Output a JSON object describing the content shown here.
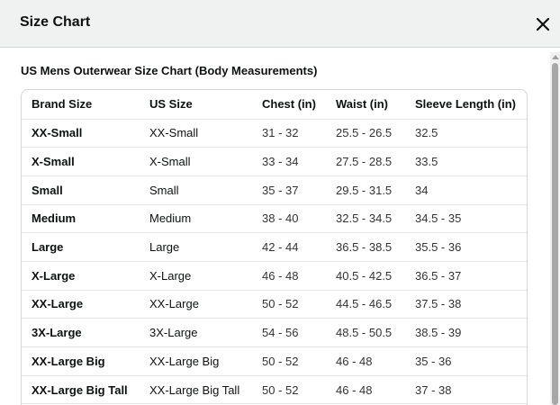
{
  "modal": {
    "title": "Size Chart"
  },
  "chart": {
    "heading": "US Mens Outerwear Size Chart (Body Measurements)",
    "columns": [
      "Brand Size",
      "US Size",
      "Chest (in)",
      "Waist (in)",
      "Sleeve Length (in)"
    ],
    "rows": [
      [
        "XX-Small",
        "XX-Small",
        "31 - 32",
        "25.5 - 26.5",
        "32.5"
      ],
      [
        "X-Small",
        "X-Small",
        "33 - 34",
        "27.5 - 28.5",
        "33.5"
      ],
      [
        "Small",
        "Small",
        "35 - 37",
        "29.5 - 31.5",
        "34"
      ],
      [
        "Medium",
        "Medium",
        "38 - 40",
        "32.5 - 34.5",
        "34.5 - 35"
      ],
      [
        "Large",
        "Large",
        "42 - 44",
        "36.5 - 38.5",
        "35.5 - 36"
      ],
      [
        "X-Large",
        "X-Large",
        "46 - 48",
        "40.5 - 42.5",
        "36.5 - 37"
      ],
      [
        "XX-Large",
        "XX-Large",
        "50 - 52",
        "44.5 - 46.5",
        "37.5 - 38"
      ],
      [
        "3X-Large",
        "3X-Large",
        "54 - 56",
        "48.5 - 50.5",
        "38.5 - 39"
      ],
      [
        "XX-Large Big",
        "XX-Large Big",
        "50 - 52",
        "46 - 48",
        "35 - 36"
      ],
      [
        "XX-Large Big Tall",
        "XX-Large Big Tall",
        "50 - 52",
        "46 - 48",
        "37 - 38"
      ]
    ]
  },
  "icons": {
    "close": "close-icon",
    "scroll_up": "scroll-up-arrow-icon"
  },
  "colors": {
    "header_bg": "#f0f2f2",
    "border": "#d5d9d9",
    "text": "#0f1111"
  }
}
